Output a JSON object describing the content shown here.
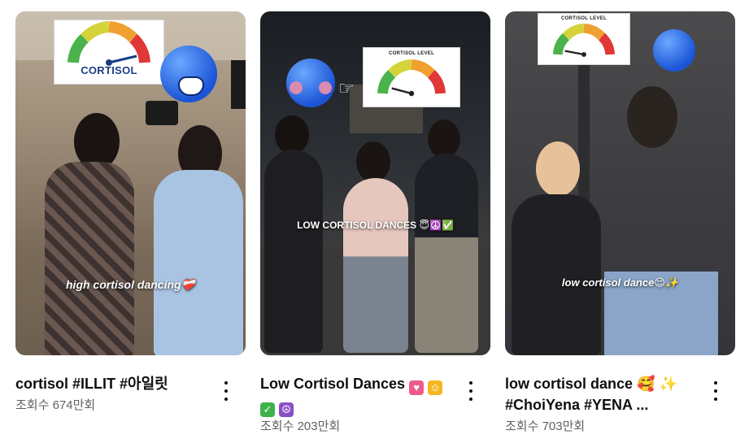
{
  "videos": [
    {
      "title": "cortisol #ILLIT #아일릿",
      "views": "조회수 674만회",
      "overlay_text": "high cortisol dancing❤️‍🩹",
      "meter_label": "CORTISOL",
      "meter_top": "MEDIUM"
    },
    {
      "title_line1": "Low Cortisol Dances",
      "title_line2": "",
      "views": "조회수 203만회",
      "overlay_text": "LOW CORTISOL DANCES 😇☮️✅",
      "meter_label": "CORTISOL LEVEL",
      "meter_top": "NORMAL"
    },
    {
      "title_line1": "low cortisol dance 🥰 ✨",
      "title_line2": "#ChoiYena #YENA ...",
      "views": "조회수 703만회",
      "overlay_text": "low cortisol dance😌✨",
      "meter_label": "CORTISOL LEVEL",
      "meter_top": "NORMAL"
    }
  ],
  "colors": {
    "accent": "#0f0f0f",
    "meta": "#606060"
  },
  "icons": [
    "more-vert-icon",
    "heart-eyes-icon",
    "halo-icon",
    "check-box-icon",
    "peace-icon"
  ]
}
